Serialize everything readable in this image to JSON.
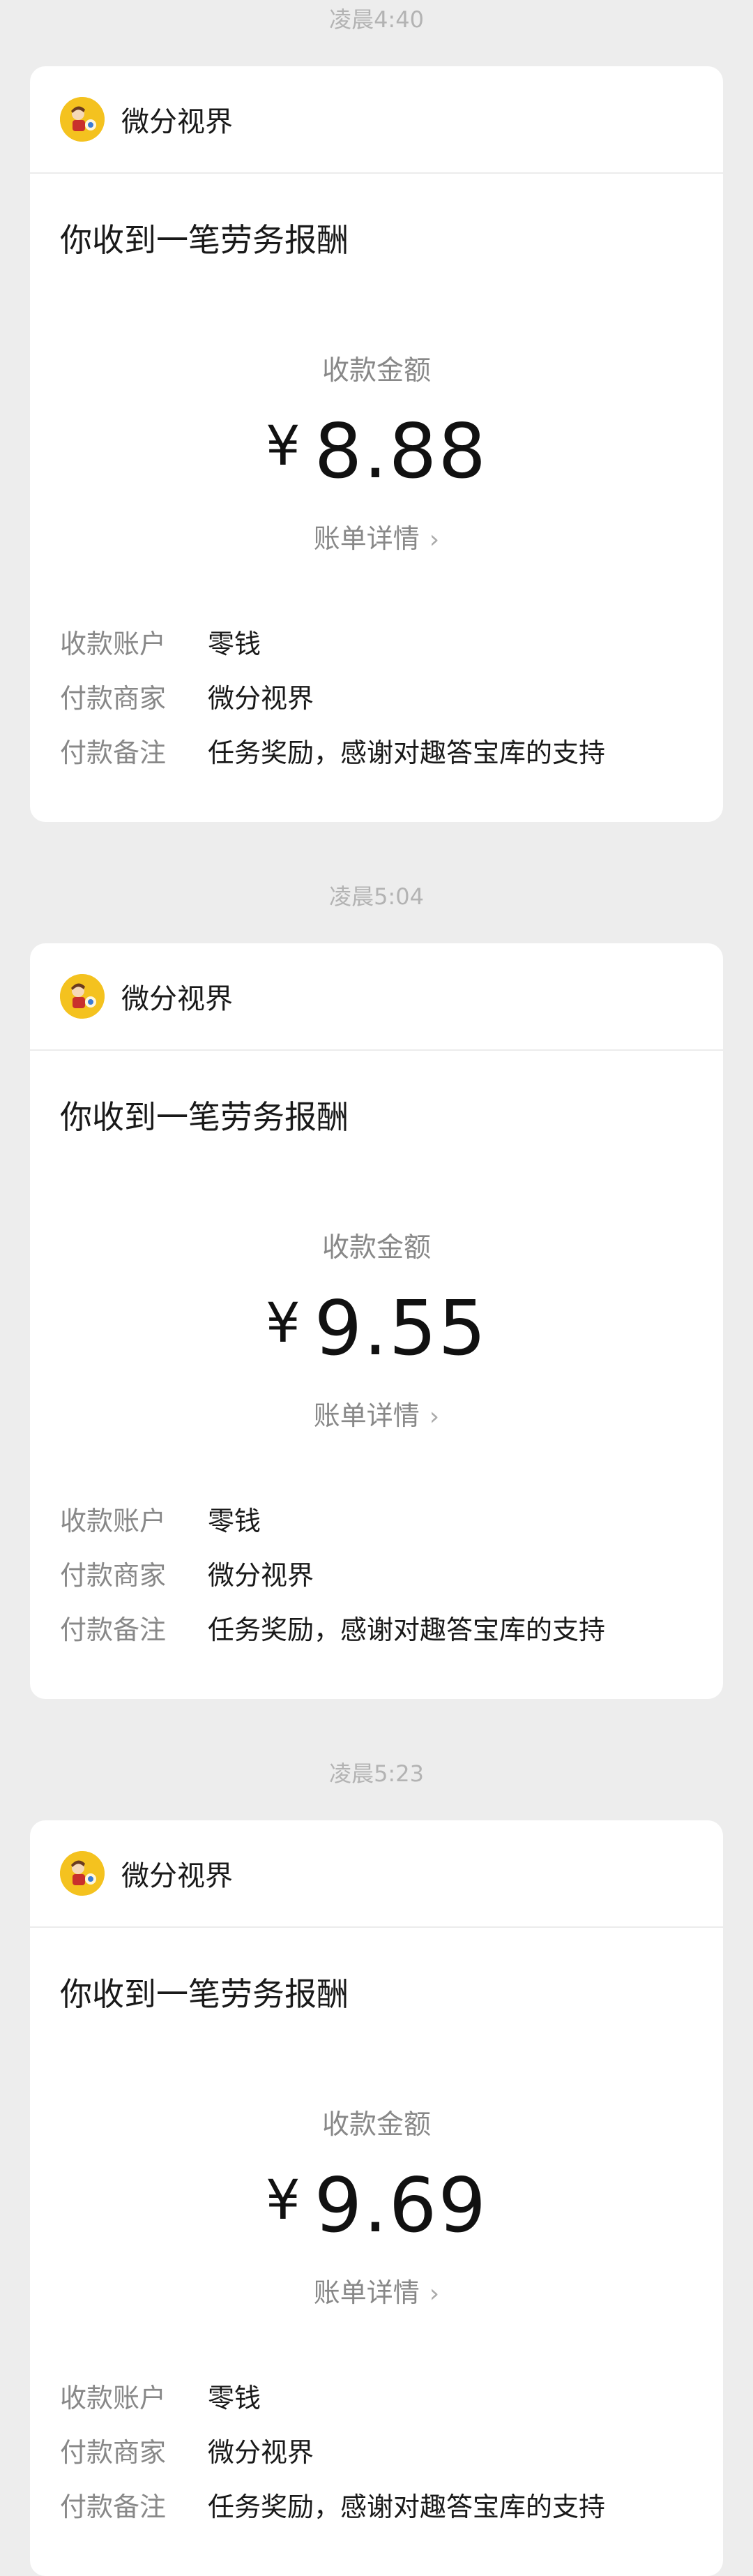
{
  "messages": [
    {
      "time": "凌晨4:40",
      "merchant": "微分视界",
      "title": "你收到一笔劳务报酬",
      "amount_label": "收款金额",
      "currency": "¥",
      "amount": "8.88",
      "bill_link": "账单详情",
      "details": [
        {
          "key": "收款账户",
          "value": "零钱"
        },
        {
          "key": "付款商家",
          "value": "微分视界"
        },
        {
          "key": "付款备注",
          "value": "任务奖励，感谢对趣答宝库的支持"
        }
      ]
    },
    {
      "time": "凌晨5:04",
      "merchant": "微分视界",
      "title": "你收到一笔劳务报酬",
      "amount_label": "收款金额",
      "currency": "¥",
      "amount": "9.55",
      "bill_link": "账单详情",
      "details": [
        {
          "key": "收款账户",
          "value": "零钱"
        },
        {
          "key": "付款商家",
          "value": "微分视界"
        },
        {
          "key": "付款备注",
          "value": "任务奖励，感谢对趣答宝库的支持"
        }
      ]
    },
    {
      "time": "凌晨5:23",
      "merchant": "微分视界",
      "title": "你收到一笔劳务报酬",
      "amount_label": "收款金额",
      "currency": "¥",
      "amount": "9.69",
      "bill_link": "账单详情",
      "details": [
        {
          "key": "收款账户",
          "value": "零钱"
        },
        {
          "key": "付款商家",
          "value": "微分视界"
        },
        {
          "key": "付款备注",
          "value": "任务奖励，感谢对趣答宝库的支持"
        }
      ]
    }
  ],
  "icons": {
    "avatar": "merchant-avatar-icon",
    "bill_chevron": "chevron-right-icon"
  },
  "colors": {
    "page_background": "#ededed",
    "card_background": "#ffffff",
    "secondary_text": "#888888",
    "timestamp_text": "#b3b3b3"
  }
}
